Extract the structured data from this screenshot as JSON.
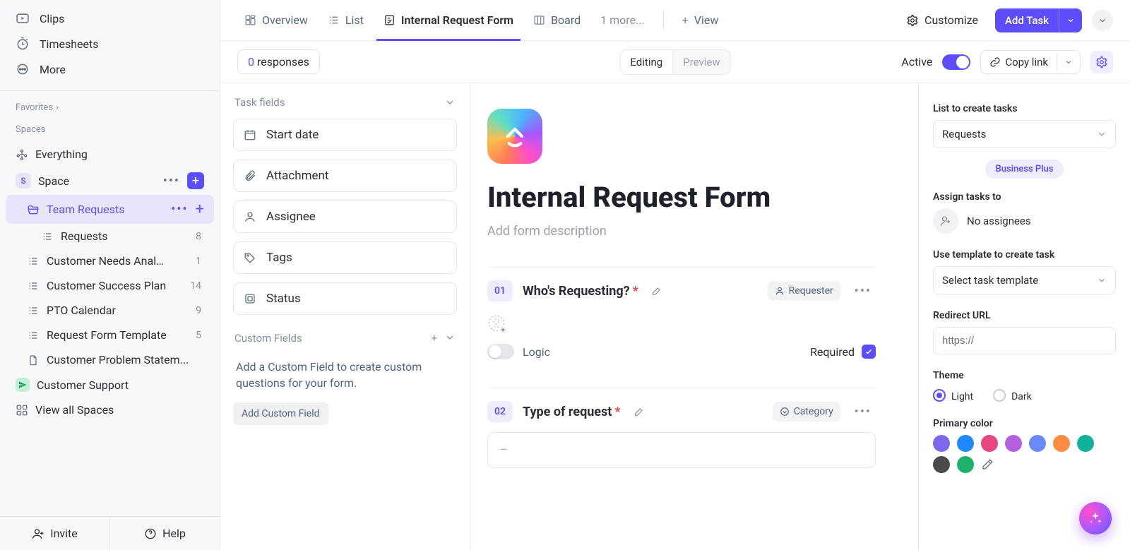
{
  "left_nav": {
    "clips": "Clips",
    "timesheets": "Timesheets",
    "more": "More",
    "favorites_label": "Favorites",
    "spaces_label": "Spaces",
    "everything": "Everything",
    "space_name": "Space",
    "space_initial": "S",
    "folder_active": "Team Requests",
    "list_requests": "Requests",
    "list_requests_count": "8",
    "list_cna": "Customer Needs Analy...",
    "list_cna_count": "1",
    "list_csp": "Customer Success Plan",
    "list_csp_count": "14",
    "list_pto": "PTO Calendar",
    "list_pto_count": "9",
    "list_rft": "Request Form Template",
    "list_rft_count": "5",
    "list_cps": "Customer Problem Statem...",
    "customer_support": "Customer Support",
    "view_all_spaces": "View all Spaces",
    "invite": "Invite",
    "help": "Help"
  },
  "tabs": {
    "overview": "Overview",
    "list": "List",
    "form": "Internal Request Form",
    "board": "Board",
    "more": "1 more...",
    "view": "View",
    "customize": "Customize",
    "add_task": "Add Task"
  },
  "subbar": {
    "responses_count": "0",
    "responses_label": "responses",
    "editing": "Editing",
    "preview": "Preview",
    "active": "Active",
    "copylink": "Copy link"
  },
  "fields_panel": {
    "task_fields": "Task fields",
    "items": {
      "start_date": "Start date",
      "attachment": "Attachment",
      "assignee": "Assignee",
      "tags": "Tags",
      "status": "Status"
    },
    "custom_fields": "Custom Fields",
    "desc": "Add a Custom Field to create custom questions for your form.",
    "add_custom_field": "Add Custom Field"
  },
  "form": {
    "title": "Internal Request Form",
    "desc_placeholder": "Add form description",
    "q1_number": "01",
    "q1_title": "Who's Requesting?",
    "q1_chip": "Requester",
    "logic": "Logic",
    "required": "Required",
    "q2_number": "02",
    "q2_title": "Type of request",
    "q2_chip": "Category",
    "select_placeholder": "–"
  },
  "settings": {
    "list_label": "List to create tasks",
    "list_value": "Requests",
    "plan_badge": "Business Plus",
    "assign_label": "Assign tasks to",
    "no_assignees": "No assignees",
    "template_label": "Use template to create task",
    "template_value": "Select task template",
    "redirect_label": "Redirect URL",
    "redirect_placeholder": "https://",
    "theme_label": "Theme",
    "theme_light": "Light",
    "theme_dark": "Dark",
    "primary_color": "Primary color",
    "swatches": [
      "#7b68ee",
      "#1f8aff",
      "#e8467f",
      "#b660e0",
      "#6b8afd",
      "#ff8c42",
      "#10b29b"
    ],
    "swatches_row2": [
      "#4a4a4a",
      "#1db26b"
    ]
  }
}
